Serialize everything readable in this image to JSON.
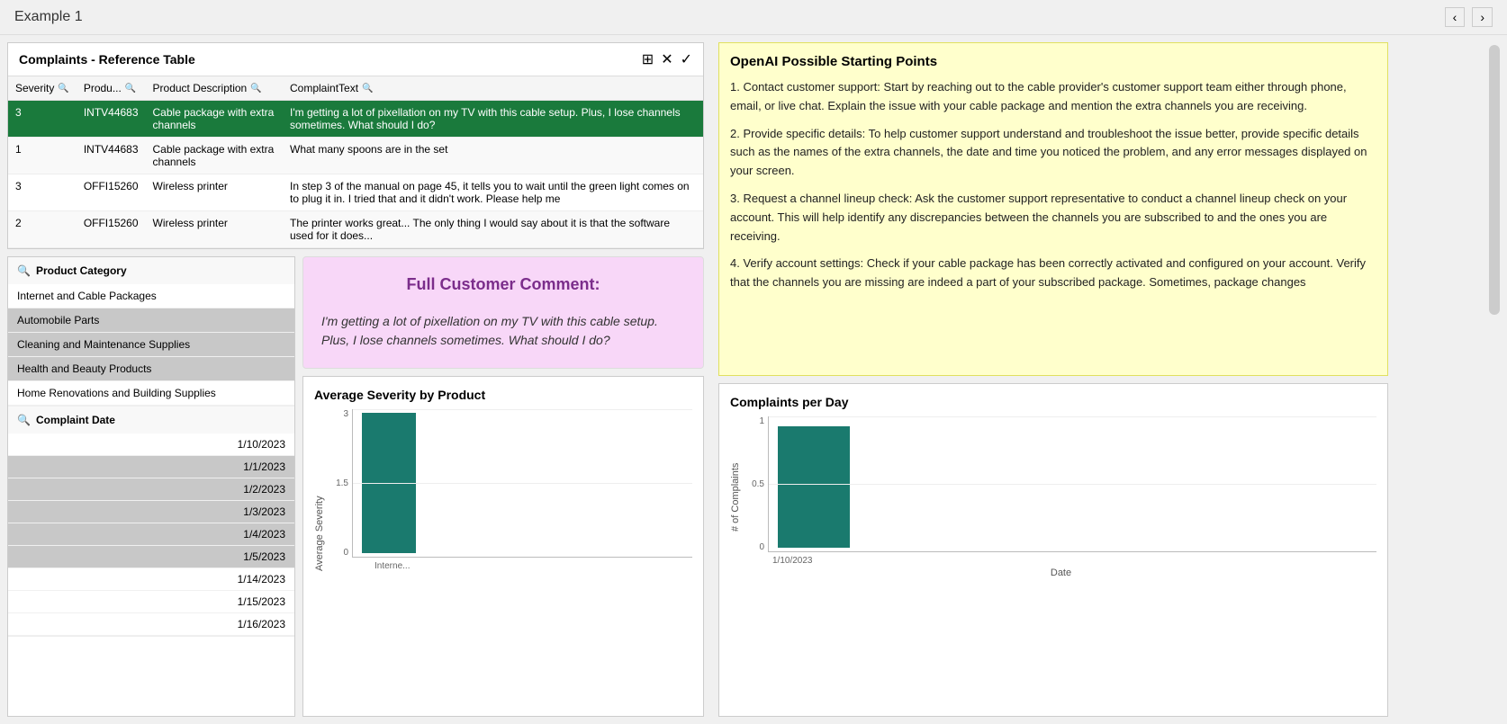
{
  "titleBar": {
    "title": "Example 1",
    "prevLabel": "‹",
    "nextLabel": "›"
  },
  "refTable": {
    "title": "Complaints - Reference Table",
    "columns": [
      "Severity",
      "Produ...",
      "Product Description",
      "ComplaintText"
    ],
    "rows": [
      {
        "severity": "3",
        "product": "INTV44683",
        "description": "Cable package with extra channels",
        "complaint": "I'm getting a lot of pixellation on my TV with this cable setup. Plus, I lose channels sometimes. What should I do?",
        "selected": true
      },
      {
        "severity": "1",
        "product": "INTV44683",
        "description": "Cable package with extra channels",
        "complaint": "What many spoons are in the set",
        "selected": false
      },
      {
        "severity": "3",
        "product": "OFFI15260",
        "description": "Wireless printer",
        "complaint": "In step 3 of the manual on page 45, it tells you to wait until the green light comes on to plug it in. I tried that and it didn't work. Please help me",
        "selected": false
      },
      {
        "severity": "2",
        "product": "OFFI15260",
        "description": "Wireless printer",
        "complaint": "The printer works great... The only thing I would say about it is that the software used for it does...",
        "selected": false
      }
    ],
    "actionIcons": [
      "⊞",
      "✕",
      "✓"
    ]
  },
  "productCategory": {
    "label": "Product Category",
    "items": [
      {
        "name": "Internet and Cable Packages",
        "selected": false
      },
      {
        "name": "Automobile Parts",
        "selected": true
      },
      {
        "name": "Cleaning and Maintenance Supplies",
        "selected": true
      },
      {
        "name": "Health and Beauty Products",
        "selected": true
      },
      {
        "name": "Home Renovations and Building Supplies",
        "selected": false
      }
    ]
  },
  "complaintDate": {
    "label": "Complaint Date",
    "dates": [
      {
        "date": "1/10/2023",
        "selected": false
      },
      {
        "date": "1/1/2023",
        "selected": true
      },
      {
        "date": "1/2/2023",
        "selected": true
      },
      {
        "date": "1/3/2023",
        "selected": true
      },
      {
        "date": "1/4/2023",
        "selected": true
      },
      {
        "date": "1/5/2023",
        "selected": true
      },
      {
        "date": "1/14/2023",
        "selected": false
      },
      {
        "date": "1/15/2023",
        "selected": false
      },
      {
        "date": "1/16/2023",
        "selected": false
      }
    ]
  },
  "fullComment": {
    "title": "Full Customer Comment:",
    "text": "I'm getting a lot of pixellation on my TV with this cable setup. Plus, I lose channels sometimes. What should I do?"
  },
  "avgSeverity": {
    "title": "Average Severity by Product",
    "yAxisLabel": "Average Severity",
    "yTicks": [
      "3",
      "1.5",
      "0"
    ],
    "bars": [
      {
        "label": "Interne...",
        "value": 3,
        "maxValue": 3
      }
    ],
    "barColor": "#1a7a6e"
  },
  "openai": {
    "title": "OpenAI Possible Starting Points",
    "text": "1. Contact customer support: Start by reaching out to the cable provider's customer support team either through phone, email, or live chat. Explain the issue with your cable package and mention the extra channels you are receiving.\n\n2. Provide specific details: To help customer support understand and troubleshoot the issue better, provide specific details such as the names of the extra channels, the date and time you noticed the problem, and any error messages displayed on your screen.\n\n3. Request a channel lineup check: Ask the customer support representative to conduct a channel lineup check on your account. This will help identify any discrepancies between the channels you are subscribed to and the ones you are receiving.\n\n4. Verify account settings: Check if your cable package has been correctly activated and configured on your account. Verify that the channels you are missing are indeed a part of your subscribed package. Sometimes, package changes"
  },
  "complaintsPerDay": {
    "title": "Complaints per Day",
    "yAxisLabel": "# of Complaints",
    "xAxisLabel": "Date",
    "yTicks": [
      "1",
      "0.5",
      "0"
    ],
    "bars": [
      {
        "label": "1/10/2023",
        "value": 1,
        "maxValue": 1
      }
    ],
    "barColor": "#1a7a6e"
  }
}
